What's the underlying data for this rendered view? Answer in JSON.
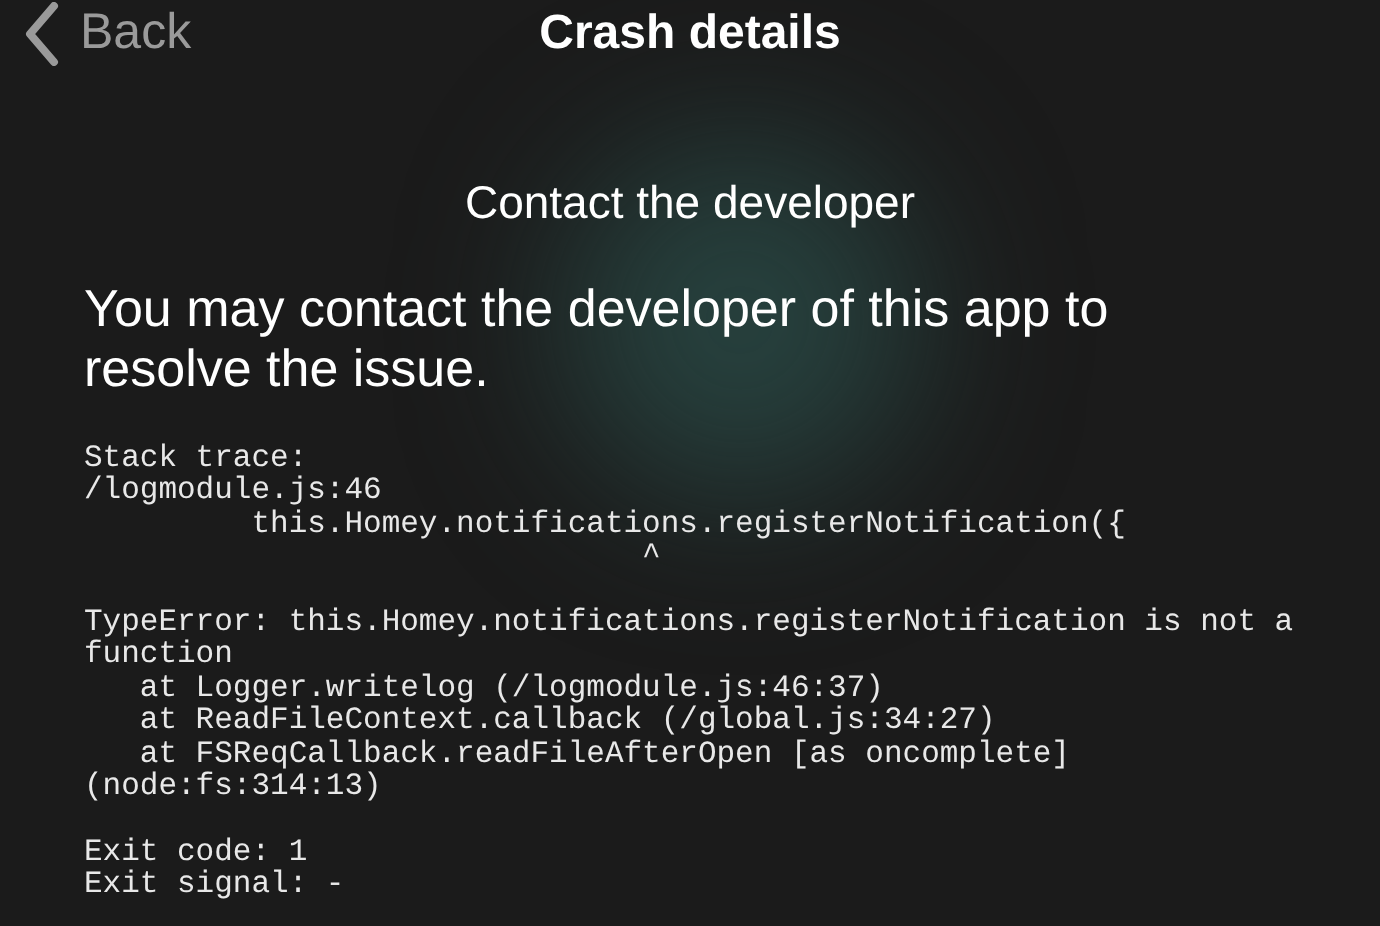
{
  "header": {
    "back": "Back",
    "title": "Crash details"
  },
  "heading": "Contact the developer",
  "message": "You may contact the developer of this app to resolve the issue.",
  "stack_blocks": [
    [
      "Stack trace:",
      "/logmodule.js:46",
      "         this.Homey.notifications.registerNotification({",
      "                              ^"
    ],
    [
      "TypeError: this.Homey.notifications.registerNotification is not a",
      "function",
      "   at Logger.writelog (/logmodule.js:46:37)",
      "   at ReadFileContext.callback (/global.js:34:27)",
      "   at FSReqCallback.readFileAfterOpen [as oncomplete]",
      "(node:fs:314:13)"
    ],
    [
      "Exit code: 1",
      "Exit signal: -"
    ]
  ]
}
